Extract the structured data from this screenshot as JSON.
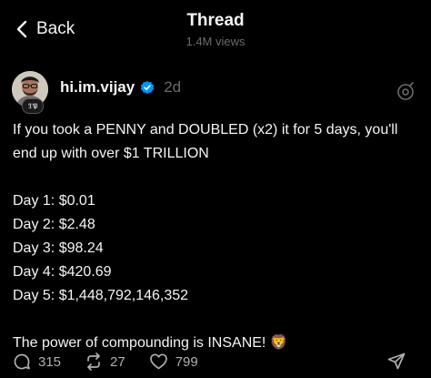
{
  "header": {
    "back_label": "Back",
    "title": "Thread",
    "views": "1.4M views"
  },
  "post": {
    "author": {
      "username": "hi.im.vijay",
      "verified": true,
      "avatar_badge": "TIPP"
    },
    "time": "2d",
    "lines": [
      "If you took a PENNY and DOUBLED (x2) it for 5 days, you'll end up with over $1 TRILLION",
      "",
      "Day 1: $0.01",
      "Day 2: $2.48",
      "Day 3: $98.24",
      "Day 4: $420.69",
      "Day 5: $1,448,792,146,352",
      "",
      "The power of compounding is INSANE! 🦁"
    ],
    "actions": {
      "replies": "315",
      "reposts": "27",
      "likes": "799"
    }
  },
  "icons": {
    "back": "chevron-left-icon",
    "verified": "verified-badge-icon",
    "more": "thread-options-icon",
    "reply": "speech-bubble-icon",
    "repost": "repost-arrows-icon",
    "like": "heart-icon",
    "share": "send-icon"
  },
  "colors": {
    "background": "#000000",
    "text": "#f3f5f7",
    "muted": "#6b6b6b",
    "verified": "#0095f6"
  }
}
